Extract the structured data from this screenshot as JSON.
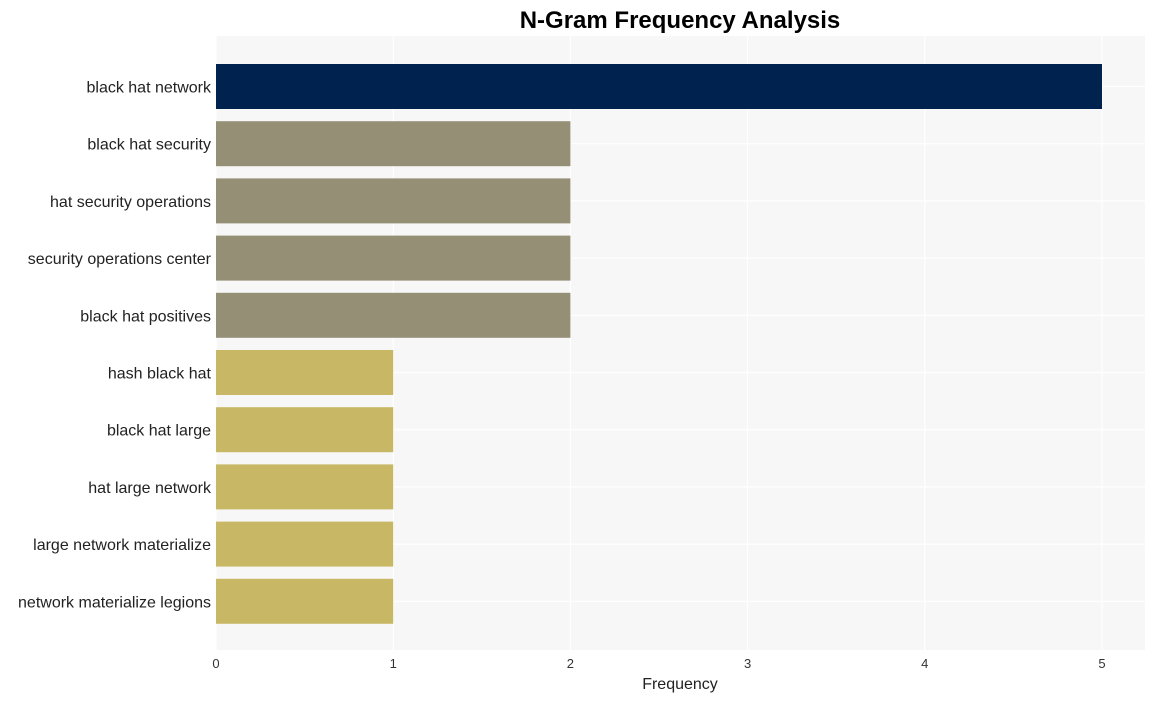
{
  "chart_data": {
    "type": "bar",
    "orientation": "horizontal",
    "title": "N-Gram Frequency Analysis",
    "xlabel": "Frequency",
    "ylabel": "",
    "xlim": [
      0,
      5.25
    ],
    "xticks": [
      0,
      1,
      2,
      3,
      4,
      5
    ],
    "grid": true,
    "categories": [
      "black hat network",
      "black hat security",
      "hat security operations",
      "security operations center",
      "black hat positives",
      "hash black hat",
      "black hat large",
      "hat large network",
      "large network materialize",
      "network materialize legions"
    ],
    "values": [
      5,
      2,
      2,
      2,
      2,
      1,
      1,
      1,
      1,
      1
    ],
    "colors": {
      "5": "#00224e",
      "2": "#958f76",
      "1": "#c8b865"
    },
    "background": "#f7f7f7",
    "gridline_color": "#ffffff"
  }
}
